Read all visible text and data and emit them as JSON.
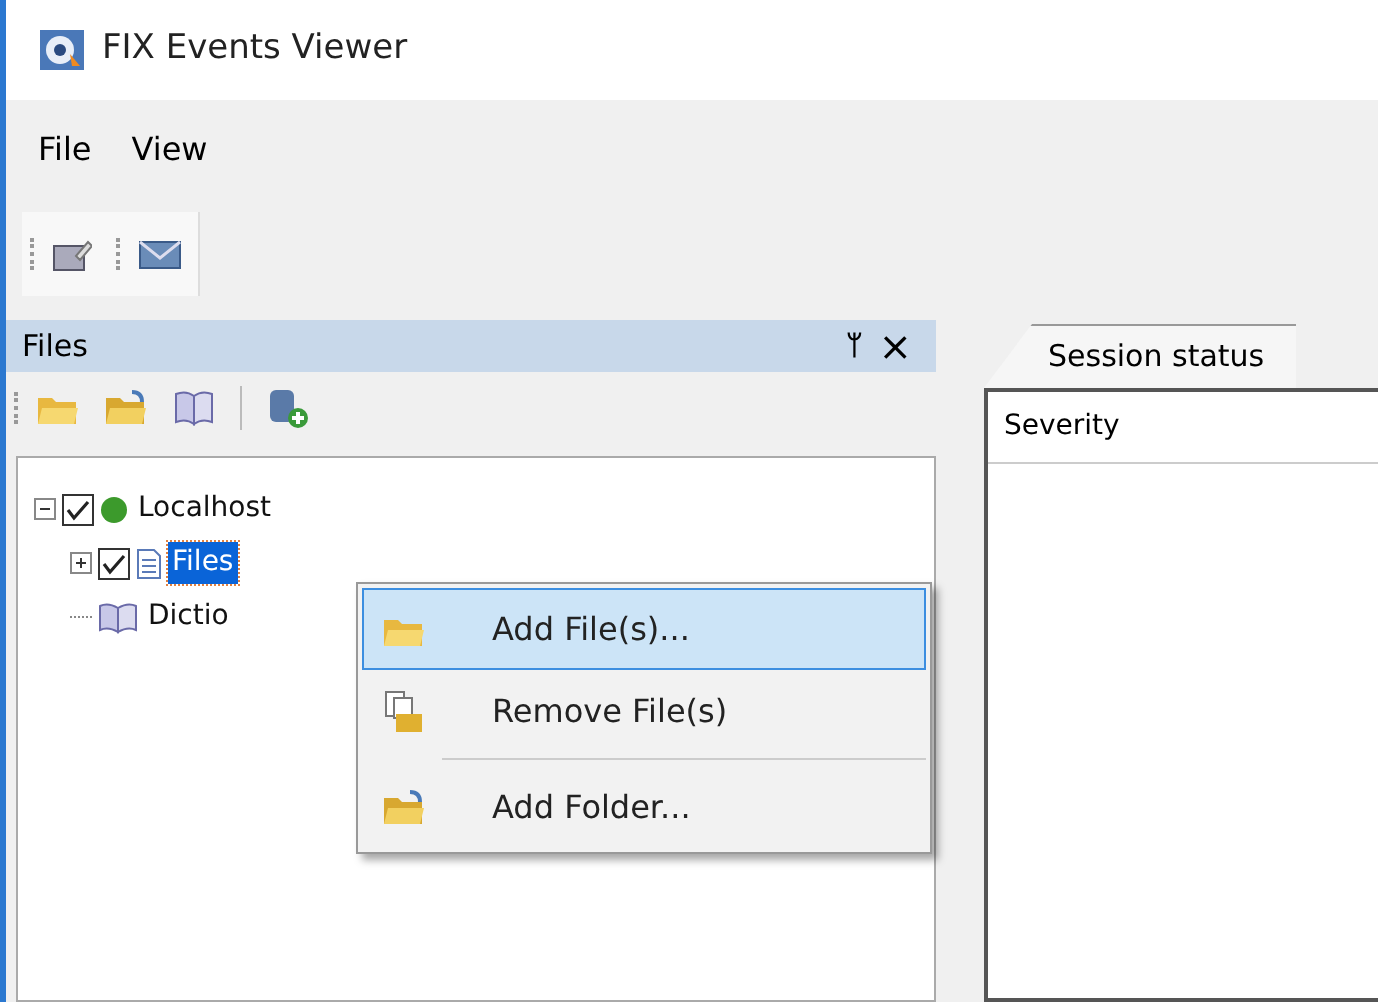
{
  "window": {
    "title": "FIX Events Viewer"
  },
  "menu": [
    "File",
    "View"
  ],
  "files_panel": {
    "title": "Files",
    "pin": "ᛘ",
    "close": "×"
  },
  "tree": [
    {
      "label": "Localhost",
      "checked": true,
      "expanded": true,
      "selected": false,
      "kind": "host",
      "children": [
        {
          "label": "Files",
          "checked": true,
          "expanded": false,
          "selected": true,
          "kind": "files"
        },
        {
          "label": "Dictio",
          "selected": false,
          "kind": "dictionary"
        }
      ]
    }
  ],
  "tabs": [
    {
      "label": "Session status",
      "selected": true
    }
  ],
  "table": {
    "columns": [
      "Severity"
    ]
  },
  "context_menu": [
    {
      "label": "Add File(s)...",
      "selected": true,
      "kind": "open"
    },
    {
      "label": "Remove File(s)",
      "selected": false,
      "kind": "remove"
    },
    {
      "kind": "separator"
    },
    {
      "label": "Add Folder...",
      "selected": false,
      "kind": "folder"
    }
  ]
}
